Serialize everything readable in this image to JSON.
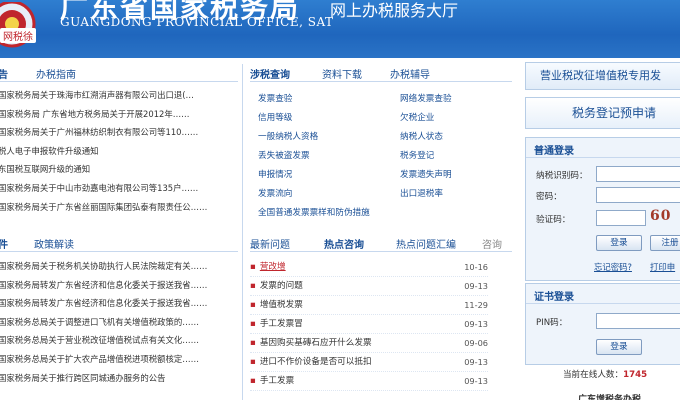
{
  "header": {
    "title_cn": "广东省国家税务局",
    "title_en": "GUANGDONG PROVINCIAL OFFICE, SAT",
    "service_title": "网上办税服务大厅",
    "badge": "网税徐"
  },
  "notice_section": {
    "tabs": [
      "告",
      "办税指南"
    ],
    "items": [
      "国家税务局关于珠海市红溯消声器有限公司出口退(…",
      "国家税务局  广东省地方税务局关于开展2012年……",
      "国家税务局关于广州福林纺织制衣有限公司等110……",
      "税人电子申报软件升级通知",
      "东国税互联网升级的通知",
      "国家税务局关于中山市劲嘉电池有限公司等135户……",
      "国家税务局关于广东省丝丽国际集团弘泰有限责任公……"
    ]
  },
  "policy_section": {
    "tabs": [
      "件",
      "政策解读"
    ],
    "items": [
      "国家税务局关于税务机关协助执行人民法院裁定有关……",
      "国家税务局转发广东省经济和信息化委关于报送我省……",
      "国家税务局转发广东省经济和信息化委关于报送我省……",
      "国家税务总局关于调整进口飞机有关增值税政策的……",
      "国家税务总局关于营业税改征增值税试点有关文化……",
      "国家税务总局关于扩大农产品增值税进项税额核定……",
      "国家税务局关于推行跨区同城通办服务的公告"
    ]
  },
  "query_section": {
    "tabs": [
      "涉税查询",
      "资料下载",
      "办税辅导"
    ],
    "col1": [
      "发票查验",
      "信用等级",
      "一般纳税人资格",
      "丢失被盗发票",
      "申报情况",
      "发票流向",
      "全国普通发票票样和防伪措施"
    ],
    "col2": [
      "网络发票查验",
      "欠税企业",
      "纳税人状态",
      "税务登记",
      "发票遗失声明",
      "出口退税率"
    ]
  },
  "hot_section": {
    "tabs": [
      "最新问题",
      "热点咨询",
      "热点问题汇编",
      "咨询"
    ],
    "items": [
      {
        "text": "营改增",
        "date": "10-16"
      },
      {
        "text": "发票的问题",
        "date": "09-13"
      },
      {
        "text": "增值税发票",
        "date": "11-29"
      },
      {
        "text": "手工发票冒",
        "date": "09-13"
      },
      {
        "text": "基因购买基磚石应开什么发票",
        "date": "09-06"
      },
      {
        "text": "进口不作价设备是否可以抵扣",
        "date": "09-13"
      },
      {
        "text": "手工发票",
        "date": "09-13"
      }
    ]
  },
  "right_panel": {
    "banner1": "营业税改征增值税专用发",
    "banner2": "税务登记预申请",
    "login": {
      "title": "普通登录",
      "taxpayer_label": "纳税识别码：",
      "password_label": "密码：",
      "captcha_label": "验证码：",
      "captcha_text": "60",
      "login_button": "登录",
      "register_button": "注册",
      "forgot": "忘记密码?",
      "extra_link": "打印申"
    },
    "cert": {
      "title": "证书登录",
      "pin_label": "PIN码：",
      "login_button": "登录"
    },
    "online_label": "当前在线人数：",
    "online_count": "1745",
    "bottom_text": "广东增税务办税"
  },
  "colors": {
    "header_blue": "#1f66bd",
    "link_blue": "#1a4f95",
    "accent_red": "#c0262d"
  }
}
